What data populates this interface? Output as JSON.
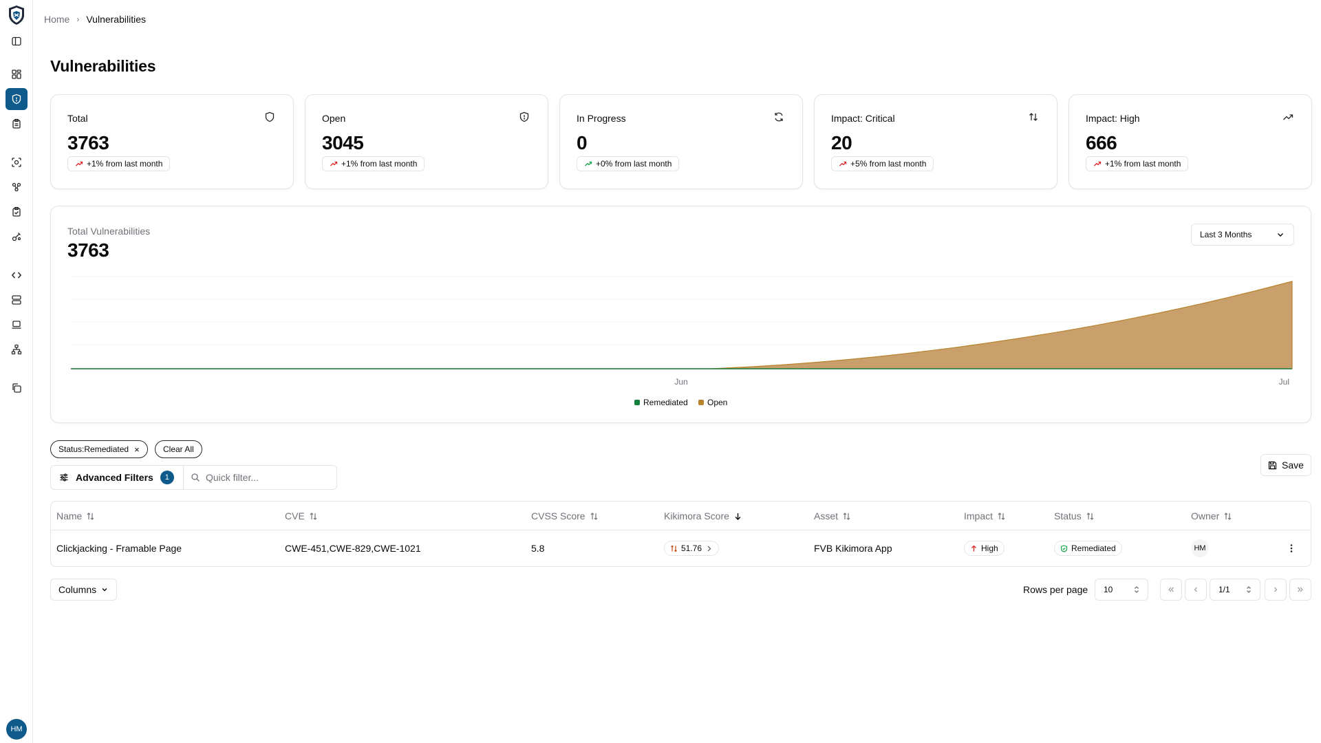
{
  "breadcrumb": {
    "home": "Home",
    "current": "Vulnerabilities"
  },
  "page_title": "Vulnerabilities",
  "sidebar": {
    "avatar_initials": "HM",
    "active_item": "vulnerabilities",
    "accent_color": "#0e5a8a"
  },
  "stats": [
    {
      "label": "Total",
      "value": "3763",
      "trend": "+1% from last month",
      "icon": "shield-icon"
    },
    {
      "label": "Open",
      "value": "3045",
      "trend": "+1% from last month",
      "icon": "shield-alert-icon"
    },
    {
      "label": "In Progress",
      "value": "0",
      "trend": "+0% from last month",
      "icon": "refresh-icon"
    },
    {
      "label": "Impact: Critical",
      "value": "20",
      "trend": "+5% from last month",
      "icon": "sort-arrows-icon"
    },
    {
      "label": "Impact: High",
      "value": "666",
      "trend": "+1% from last month",
      "icon": "trending-up-icon"
    }
  ],
  "chart": {
    "label": "Total Vulnerabilities",
    "total": "3763",
    "range": "Last 3 Months"
  },
  "chart_data": {
    "type": "area",
    "x": [
      "Jun",
      "Jul"
    ],
    "series": [
      {
        "name": "Remediated",
        "color": "#15803d"
      },
      {
        "name": "Open",
        "color": "#b7832c"
      }
    ],
    "xlabel": "",
    "ylabel": "",
    "grid": true,
    "legend": "bottom-center"
  },
  "filters": {
    "chips": [
      "Status:Remediated",
      "Clear All"
    ],
    "advanced_label": "Advanced Filters",
    "advanced_count": "1",
    "quick_placeholder": "Quick filter...",
    "save_label": "Save"
  },
  "table": {
    "columns": [
      "Name",
      "CVE",
      "CVSS Score",
      "Kikimora Score",
      "Asset",
      "Impact",
      "Status",
      "Owner"
    ],
    "rows": [
      {
        "name": "Clickjacking - Framable Page",
        "cve": "CWE-451,CWE-829,CWE-1021",
        "cvss": "5.8",
        "kikimora": "51.76",
        "asset": "FVB Kikimora App",
        "impact": "High",
        "status": "Remediated",
        "owner": "HM"
      }
    ]
  },
  "footer": {
    "columns_label": "Columns",
    "rows_per_page_label": "Rows per page",
    "rows_per_page": "10",
    "page": "1/1"
  }
}
